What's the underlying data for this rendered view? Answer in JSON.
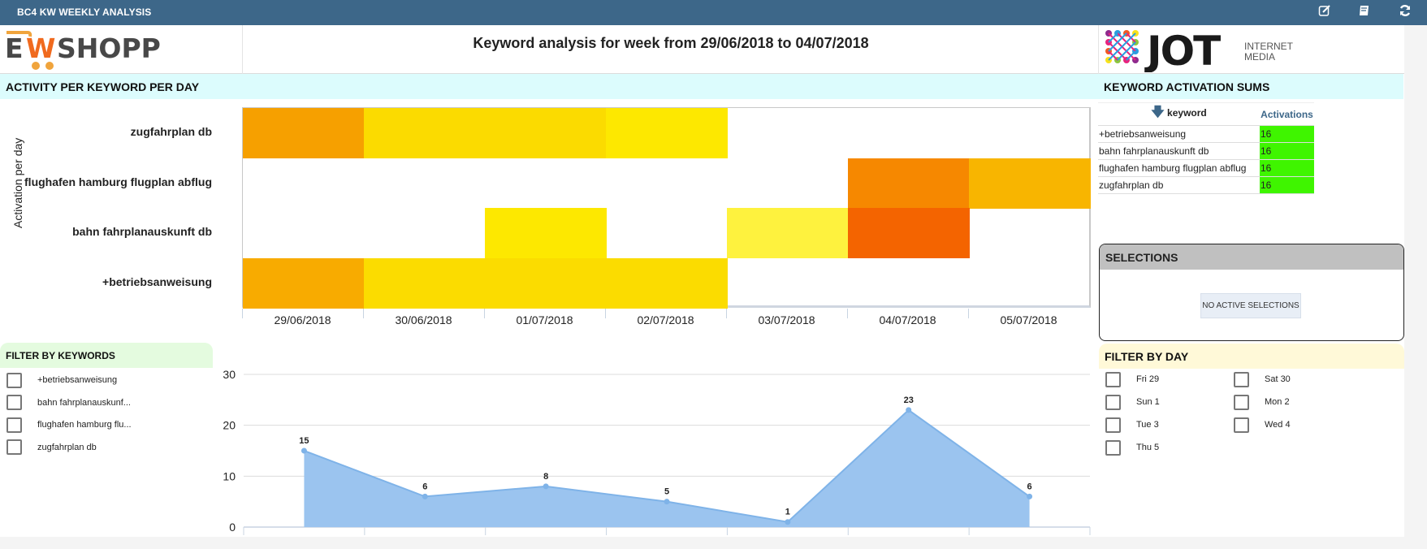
{
  "topbar": {
    "title": "BC4 KW WEEKLY ANALYSIS",
    "icons": [
      "edit-icon",
      "bookmark-icon",
      "refresh-icon"
    ]
  },
  "header": {
    "left_logo": "EWSHOPP",
    "report_title": "Keyword analysis for week from 29/06/2018 to  04/07/2018",
    "right_logo_main": "JOT",
    "right_logo_sub1": "INTERNET",
    "right_logo_sub2": "MEDIA"
  },
  "activity_section": {
    "title": "ACTIVITY PER KEYWORD PER DAY"
  },
  "sums_section": {
    "title": "KEYWORD ACTIVATION SUMS",
    "columns": [
      "keyword",
      "Activations"
    ],
    "sort_icon": "arrow-down-icon",
    "rows": [
      {
        "keyword": "+betriebsanweisung",
        "activations": "16"
      },
      {
        "keyword": "bahn fahrplanauskunft db",
        "activations": "16"
      },
      {
        "keyword": "flughafen hamburg flugplan abflug",
        "activations": "16"
      },
      {
        "keyword": "zugfahrplan db",
        "activations": "16"
      }
    ],
    "highlight_color": "#3ff500"
  },
  "selections": {
    "title": "SELECTIONS",
    "empty_label": "NO ACTIVE SELECTIONS"
  },
  "filter_keywords": {
    "title": "FILTER BY KEYWORDS",
    "items": [
      "+betriebsanweisung",
      "bahn fahrplanauskunf...",
      "flughafen hamburg flu...",
      "zugfahrplan db"
    ]
  },
  "filter_day": {
    "title": "FILTER BY DAY",
    "items": [
      "Fri 29",
      "Sat 30",
      "Sun 1",
      "Mon 2",
      "Tue 3",
      "Wed 4",
      "Thu 5"
    ]
  },
  "chart_data": [
    {
      "type": "heatmap",
      "title": "ACTIVITY PER KEYWORD PER DAY",
      "ylabel": "Activation per day",
      "xlabel": "",
      "categories": [
        "29/06/2018",
        "30/06/2018",
        "01/07/2018",
        "02/07/2018",
        "03/07/2018",
        "04/07/2018",
        "05/07/2018"
      ],
      "rows": [
        "zugfahrplan db",
        "flughafen hamburg flugplan abflug",
        "bahn fahrplanauskunft db",
        "+betriebsanweisung"
      ],
      "cell_colors": [
        [
          "#f6a000",
          "#fbdb00",
          "#fbdb00",
          "#fde800",
          null,
          null,
          null
        ],
        [
          null,
          null,
          null,
          null,
          null,
          "#f68800",
          "#f8b500"
        ],
        [
          null,
          null,
          "#fde800",
          null,
          "#fef23e",
          "#f46400",
          null
        ],
        [
          "#f8ab00",
          "#fbdc00",
          "#fbdc00",
          "#fbdc00",
          null,
          null,
          null
        ]
      ],
      "legend": "none"
    },
    {
      "type": "area",
      "title": "",
      "xlabel": "",
      "ylabel": "",
      "x": [
        "29/06/2018",
        "30/06/2018",
        "01/07/2018",
        "02/07/2018",
        "03/07/2018",
        "04/07/2018",
        "05/07/2018"
      ],
      "series": [
        {
          "name": "Activations",
          "values": [
            15,
            6,
            8,
            5,
            1,
            23,
            6
          ],
          "color": "#7fb3e8"
        }
      ],
      "yticks": [
        0,
        10,
        20,
        30
      ],
      "ylim": [
        0,
        30
      ],
      "grid": true,
      "data_labels": true
    }
  ]
}
